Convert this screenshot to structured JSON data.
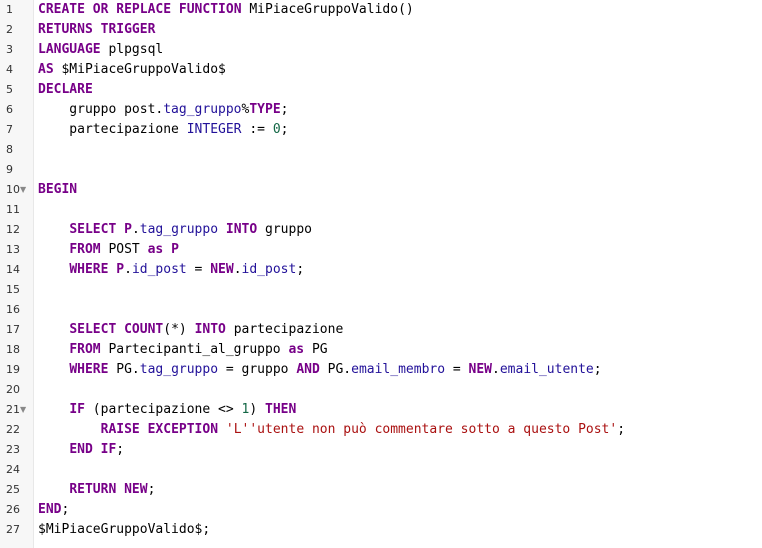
{
  "colors": {
    "keyword": "#770088",
    "type": "#221199",
    "number": "#116644",
    "string": "#aa1111",
    "gutter_bg": "#f7f7f7",
    "text": "#000000"
  },
  "lines": [
    {
      "n": "1",
      "fold": false,
      "tokens": [
        {
          "c": "k",
          "t": "CREATE"
        },
        {
          "c": "o",
          "t": " "
        },
        {
          "c": "k",
          "t": "OR"
        },
        {
          "c": "o",
          "t": " "
        },
        {
          "c": "k",
          "t": "REPLACE"
        },
        {
          "c": "o",
          "t": " "
        },
        {
          "c": "k",
          "t": "FUNCTION"
        },
        {
          "c": "o",
          "t": " MiPiaceGruppoValido()"
        }
      ]
    },
    {
      "n": "2",
      "fold": false,
      "tokens": [
        {
          "c": "k",
          "t": "RETURNS"
        },
        {
          "c": "o",
          "t": " "
        },
        {
          "c": "k",
          "t": "TRIGGER"
        }
      ]
    },
    {
      "n": "3",
      "fold": false,
      "tokens": [
        {
          "c": "k",
          "t": "LANGUAGE"
        },
        {
          "c": "o",
          "t": " plpgsql"
        }
      ]
    },
    {
      "n": "4",
      "fold": false,
      "tokens": [
        {
          "c": "k",
          "t": "AS"
        },
        {
          "c": "o",
          "t": " $MiPiaceGruppoValido$"
        }
      ]
    },
    {
      "n": "5",
      "fold": false,
      "tokens": [
        {
          "c": "k",
          "t": "DECLARE"
        }
      ]
    },
    {
      "n": "6",
      "fold": false,
      "tokens": [
        {
          "c": "o",
          "t": "    gruppo post."
        },
        {
          "c": "p",
          "t": "tag_gruppo"
        },
        {
          "c": "o",
          "t": "%"
        },
        {
          "c": "k",
          "t": "TYPE"
        },
        {
          "c": "o",
          "t": ";"
        }
      ]
    },
    {
      "n": "7",
      "fold": false,
      "tokens": [
        {
          "c": "o",
          "t": "    partecipazione "
        },
        {
          "c": "p",
          "t": "INTEGER"
        },
        {
          "c": "o",
          "t": " := "
        },
        {
          "c": "n",
          "t": "0"
        },
        {
          "c": "o",
          "t": ";"
        }
      ]
    },
    {
      "n": "8",
      "fold": false,
      "tokens": []
    },
    {
      "n": "9",
      "fold": false,
      "tokens": []
    },
    {
      "n": "10",
      "fold": true,
      "tokens": [
        {
          "c": "k",
          "t": "BEGIN"
        }
      ]
    },
    {
      "n": "11",
      "fold": false,
      "tokens": []
    },
    {
      "n": "12",
      "fold": false,
      "tokens": [
        {
          "c": "o",
          "t": "    "
        },
        {
          "c": "k",
          "t": "SELECT"
        },
        {
          "c": "o",
          "t": " "
        },
        {
          "c": "k",
          "t": "P"
        },
        {
          "c": "o",
          "t": "."
        },
        {
          "c": "p",
          "t": "tag_gruppo"
        },
        {
          "c": "o",
          "t": " "
        },
        {
          "c": "k",
          "t": "INTO"
        },
        {
          "c": "o",
          "t": " gruppo"
        }
      ]
    },
    {
      "n": "13",
      "fold": false,
      "tokens": [
        {
          "c": "o",
          "t": "    "
        },
        {
          "c": "k",
          "t": "FROM"
        },
        {
          "c": "o",
          "t": " POST "
        },
        {
          "c": "k",
          "t": "as"
        },
        {
          "c": "o",
          "t": " "
        },
        {
          "c": "k",
          "t": "P"
        }
      ]
    },
    {
      "n": "14",
      "fold": false,
      "tokens": [
        {
          "c": "o",
          "t": "    "
        },
        {
          "c": "k",
          "t": "WHERE"
        },
        {
          "c": "o",
          "t": " "
        },
        {
          "c": "k",
          "t": "P"
        },
        {
          "c": "o",
          "t": "."
        },
        {
          "c": "p",
          "t": "id_post"
        },
        {
          "c": "o",
          "t": " = "
        },
        {
          "c": "k",
          "t": "NEW"
        },
        {
          "c": "o",
          "t": "."
        },
        {
          "c": "p",
          "t": "id_post"
        },
        {
          "c": "o",
          "t": ";"
        }
      ]
    },
    {
      "n": "15",
      "fold": false,
      "tokens": []
    },
    {
      "n": "16",
      "fold": false,
      "tokens": []
    },
    {
      "n": "17",
      "fold": false,
      "tokens": [
        {
          "c": "o",
          "t": "    "
        },
        {
          "c": "k",
          "t": "SELECT"
        },
        {
          "c": "o",
          "t": " "
        },
        {
          "c": "k",
          "t": "COUNT"
        },
        {
          "c": "o",
          "t": "(*) "
        },
        {
          "c": "k",
          "t": "INTO"
        },
        {
          "c": "o",
          "t": " partecipazione"
        }
      ]
    },
    {
      "n": "18",
      "fold": false,
      "tokens": [
        {
          "c": "o",
          "t": "    "
        },
        {
          "c": "k",
          "t": "FROM"
        },
        {
          "c": "o",
          "t": " Partecipanti_al_gruppo "
        },
        {
          "c": "k",
          "t": "as"
        },
        {
          "c": "o",
          "t": " PG"
        }
      ]
    },
    {
      "n": "19",
      "fold": false,
      "tokens": [
        {
          "c": "o",
          "t": "    "
        },
        {
          "c": "k",
          "t": "WHERE"
        },
        {
          "c": "o",
          "t": " PG."
        },
        {
          "c": "p",
          "t": "tag_gruppo"
        },
        {
          "c": "o",
          "t": " = gruppo "
        },
        {
          "c": "k",
          "t": "AND"
        },
        {
          "c": "o",
          "t": " PG."
        },
        {
          "c": "p",
          "t": "email_membro"
        },
        {
          "c": "o",
          "t": " = "
        },
        {
          "c": "k",
          "t": "NEW"
        },
        {
          "c": "o",
          "t": "."
        },
        {
          "c": "p",
          "t": "email_utente"
        },
        {
          "c": "o",
          "t": ";"
        }
      ]
    },
    {
      "n": "20",
      "fold": false,
      "tokens": []
    },
    {
      "n": "21",
      "fold": true,
      "tokens": [
        {
          "c": "o",
          "t": "    "
        },
        {
          "c": "k",
          "t": "IF"
        },
        {
          "c": "o",
          "t": " (partecipazione <> "
        },
        {
          "c": "n",
          "t": "1"
        },
        {
          "c": "o",
          "t": ") "
        },
        {
          "c": "k",
          "t": "THEN"
        }
      ]
    },
    {
      "n": "22",
      "fold": false,
      "tokens": [
        {
          "c": "o",
          "t": "        "
        },
        {
          "c": "k",
          "t": "RAISE"
        },
        {
          "c": "o",
          "t": " "
        },
        {
          "c": "k",
          "t": "EXCEPTION"
        },
        {
          "c": "o",
          "t": " "
        },
        {
          "c": "s",
          "t": "'L''utente non può commentare sotto a questo Post'"
        },
        {
          "c": "o",
          "t": ";"
        }
      ]
    },
    {
      "n": "23",
      "fold": false,
      "tokens": [
        {
          "c": "o",
          "t": "    "
        },
        {
          "c": "k",
          "t": "END"
        },
        {
          "c": "o",
          "t": " "
        },
        {
          "c": "k",
          "t": "IF"
        },
        {
          "c": "o",
          "t": ";"
        }
      ]
    },
    {
      "n": "24",
      "fold": false,
      "tokens": []
    },
    {
      "n": "25",
      "fold": false,
      "tokens": [
        {
          "c": "o",
          "t": "    "
        },
        {
          "c": "k",
          "t": "RETURN"
        },
        {
          "c": "o",
          "t": " "
        },
        {
          "c": "k",
          "t": "NEW"
        },
        {
          "c": "o",
          "t": ";"
        }
      ]
    },
    {
      "n": "26",
      "fold": false,
      "tokens": [
        {
          "c": "k",
          "t": "END"
        },
        {
          "c": "o",
          "t": ";"
        }
      ]
    },
    {
      "n": "27",
      "fold": false,
      "tokens": [
        {
          "c": "o",
          "t": "$MiPiaceGruppoValido$;"
        }
      ]
    }
  ],
  "fold_marker": "▼"
}
